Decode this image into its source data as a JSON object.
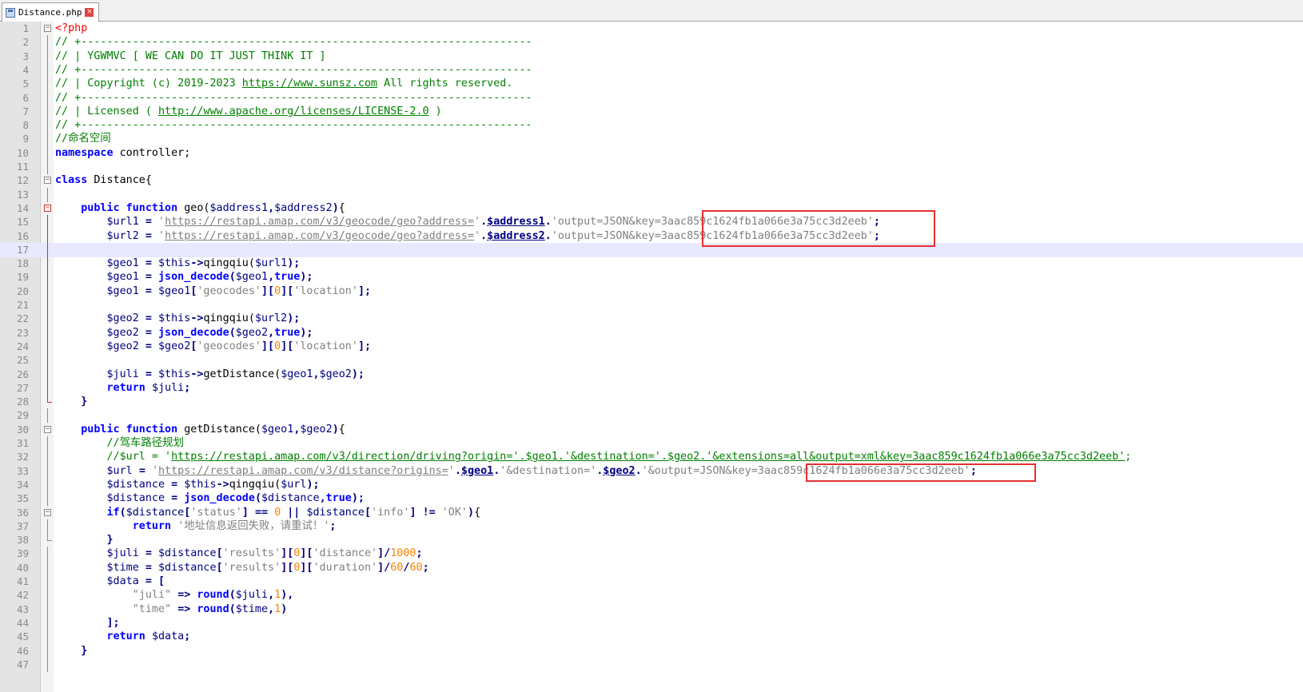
{
  "tab": {
    "filename": "Distance.php",
    "close_glyph": "×"
  },
  "lines": [
    [
      [
        "ph",
        "<?php"
      ]
    ],
    [
      [
        "cm",
        "// +----------------------------------------------------------------------"
      ]
    ],
    [
      [
        "cm",
        "// | YGWMVC [ WE CAN DO IT JUST THINK IT ]"
      ]
    ],
    [
      [
        "cm",
        "// +----------------------------------------------------------------------"
      ]
    ],
    [
      [
        "cm",
        "// | Copyright (c) 2019-2023 "
      ],
      [
        "cm url",
        "https://www.sunsz.com"
      ],
      [
        "cm",
        " All rights reserved."
      ]
    ],
    [
      [
        "cm",
        "// +----------------------------------------------------------------------"
      ]
    ],
    [
      [
        "cm",
        "// | Licensed ( "
      ],
      [
        "cm url",
        "http://www.apache.org/licenses/LICENSE-2.0"
      ],
      [
        "cm",
        " )"
      ]
    ],
    [
      [
        "cm",
        "// +----------------------------------------------------------------------"
      ]
    ],
    [
      [
        "cm",
        "//命名空间"
      ]
    ],
    [
      [
        "kw",
        "namespace"
      ],
      [
        "pl",
        " controller;"
      ]
    ],
    [],
    [
      [
        "kw",
        "class"
      ],
      [
        "pl",
        " Distance{"
      ]
    ],
    [],
    [
      [
        "pl",
        "    "
      ],
      [
        "kw",
        "public function"
      ],
      [
        "pl",
        " geo("
      ],
      [
        "vr",
        "$address1"
      ],
      [
        "op",
        ","
      ],
      [
        "vr",
        "$address2"
      ],
      [
        "op",
        ")"
      ],
      [
        "pl",
        "{"
      ]
    ],
    [
      [
        "pl",
        "        "
      ],
      [
        "vr",
        "$url1"
      ],
      [
        "pl",
        " "
      ],
      [
        "op",
        "="
      ],
      [
        "pl",
        " "
      ],
      [
        "st",
        "'"
      ],
      [
        "st url",
        "https://restapi.amap.com/v3/geocode/geo?address="
      ],
      [
        "st",
        "'"
      ],
      [
        "op",
        "."
      ],
      [
        "sv",
        "$address1"
      ],
      [
        "op",
        "."
      ],
      [
        "st",
        "'output=JSON&key=3aac859c1624fb1a066e3a75cc3d2eeb'"
      ],
      [
        "op",
        ";"
      ]
    ],
    [
      [
        "pl",
        "        "
      ],
      [
        "vr",
        "$url2"
      ],
      [
        "pl",
        " "
      ],
      [
        "op",
        "="
      ],
      [
        "pl",
        " "
      ],
      [
        "st",
        "'"
      ],
      [
        "st url",
        "https://restapi.amap.com/v3/geocode/geo?address="
      ],
      [
        "st",
        "'"
      ],
      [
        "op",
        "."
      ],
      [
        "sv",
        "$address2"
      ],
      [
        "op",
        "."
      ],
      [
        "st",
        "'output=JSON&key=3aac859c1624fb1a066e3a75cc3d2eeb'"
      ],
      [
        "op",
        ";"
      ]
    ],
    [],
    [
      [
        "pl",
        "        "
      ],
      [
        "vr",
        "$geo1"
      ],
      [
        "pl",
        " "
      ],
      [
        "op",
        "="
      ],
      [
        "pl",
        " "
      ],
      [
        "vr",
        "$this"
      ],
      [
        "op",
        "->"
      ],
      [
        "pl",
        "qingqiu("
      ],
      [
        "vr",
        "$url1"
      ],
      [
        "op",
        ");"
      ]
    ],
    [
      [
        "pl",
        "        "
      ],
      [
        "vr",
        "$geo1"
      ],
      [
        "pl",
        " "
      ],
      [
        "op",
        "="
      ],
      [
        "pl",
        " "
      ],
      [
        "kw",
        "json_decode"
      ],
      [
        "op",
        "("
      ],
      [
        "vr",
        "$geo1"
      ],
      [
        "op",
        ","
      ],
      [
        "kw",
        "true"
      ],
      [
        "op",
        ");"
      ]
    ],
    [
      [
        "pl",
        "        "
      ],
      [
        "vr",
        "$geo1"
      ],
      [
        "pl",
        " "
      ],
      [
        "op",
        "="
      ],
      [
        "pl",
        " "
      ],
      [
        "vr",
        "$geo1"
      ],
      [
        "op",
        "["
      ],
      [
        "st",
        "'geocodes'"
      ],
      [
        "op",
        "]["
      ],
      [
        "nu",
        "0"
      ],
      [
        "op",
        "]["
      ],
      [
        "st",
        "'location'"
      ],
      [
        "op",
        "];"
      ]
    ],
    [],
    [
      [
        "pl",
        "        "
      ],
      [
        "vr",
        "$geo2"
      ],
      [
        "pl",
        " "
      ],
      [
        "op",
        "="
      ],
      [
        "pl",
        " "
      ],
      [
        "vr",
        "$this"
      ],
      [
        "op",
        "->"
      ],
      [
        "pl",
        "qingqiu("
      ],
      [
        "vr",
        "$url2"
      ],
      [
        "op",
        ");"
      ]
    ],
    [
      [
        "pl",
        "        "
      ],
      [
        "vr",
        "$geo2"
      ],
      [
        "pl",
        " "
      ],
      [
        "op",
        "="
      ],
      [
        "pl",
        " "
      ],
      [
        "kw",
        "json_decode"
      ],
      [
        "op",
        "("
      ],
      [
        "vr",
        "$geo2"
      ],
      [
        "op",
        ","
      ],
      [
        "kw",
        "true"
      ],
      [
        "op",
        ");"
      ]
    ],
    [
      [
        "pl",
        "        "
      ],
      [
        "vr",
        "$geo2"
      ],
      [
        "pl",
        " "
      ],
      [
        "op",
        "="
      ],
      [
        "pl",
        " "
      ],
      [
        "vr",
        "$geo2"
      ],
      [
        "op",
        "["
      ],
      [
        "st",
        "'geocodes'"
      ],
      [
        "op",
        "]["
      ],
      [
        "nu",
        "0"
      ],
      [
        "op",
        "]["
      ],
      [
        "st",
        "'location'"
      ],
      [
        "op",
        "];"
      ]
    ],
    [],
    [
      [
        "pl",
        "        "
      ],
      [
        "vr",
        "$juli"
      ],
      [
        "pl",
        " "
      ],
      [
        "op",
        "="
      ],
      [
        "pl",
        " "
      ],
      [
        "vr",
        "$this"
      ],
      [
        "op",
        "->"
      ],
      [
        "pl",
        "getDistance("
      ],
      [
        "vr",
        "$geo1"
      ],
      [
        "op",
        ","
      ],
      [
        "vr",
        "$geo2"
      ],
      [
        "op",
        ");"
      ]
    ],
    [
      [
        "pl",
        "        "
      ],
      [
        "kw",
        "return"
      ],
      [
        "pl",
        " "
      ],
      [
        "vr",
        "$juli"
      ],
      [
        "op",
        ";"
      ]
    ],
    [
      [
        "pl",
        "    "
      ],
      [
        "op",
        "}"
      ]
    ],
    [],
    [
      [
        "pl",
        "    "
      ],
      [
        "kw",
        "public function"
      ],
      [
        "pl",
        " getDistance("
      ],
      [
        "vr",
        "$geo1"
      ],
      [
        "op",
        ","
      ],
      [
        "vr",
        "$geo2"
      ],
      [
        "op",
        ")"
      ],
      [
        "pl",
        "{"
      ]
    ],
    [
      [
        "pl",
        "        "
      ],
      [
        "cm",
        "//驾车路径规划"
      ]
    ],
    [
      [
        "pl",
        "        "
      ],
      [
        "cm",
        "//$url = '"
      ],
      [
        "cm url",
        "https://restapi.amap.com/v3/direction/driving?origin='.$geo1.'&destination='.$geo2.'&extensions=all&output=xml&key=3aac859c1624fb1a066e3a75cc3d2eeb'"
      ],
      [
        "cm",
        ";"
      ]
    ],
    [
      [
        "pl",
        "        "
      ],
      [
        "vr",
        "$url"
      ],
      [
        "pl",
        " "
      ],
      [
        "op",
        "="
      ],
      [
        "pl",
        " "
      ],
      [
        "st",
        "'"
      ],
      [
        "st url",
        "https://restapi.amap.com/v3/distance?origins="
      ],
      [
        "st",
        "'"
      ],
      [
        "op",
        "."
      ],
      [
        "sv",
        "$geo1"
      ],
      [
        "op",
        "."
      ],
      [
        "st",
        "'&destination='"
      ],
      [
        "op",
        "."
      ],
      [
        "sv",
        "$geo2"
      ],
      [
        "op",
        "."
      ],
      [
        "st",
        "'&output=JSON&key=3aac859c1624fb1a066e3a75cc3d2eeb'"
      ],
      [
        "op",
        ";"
      ]
    ],
    [
      [
        "pl",
        "        "
      ],
      [
        "vr",
        "$distance"
      ],
      [
        "pl",
        " "
      ],
      [
        "op",
        "="
      ],
      [
        "pl",
        " "
      ],
      [
        "vr",
        "$this"
      ],
      [
        "op",
        "->"
      ],
      [
        "pl",
        "qingqiu("
      ],
      [
        "vr",
        "$url"
      ],
      [
        "op",
        ");"
      ]
    ],
    [
      [
        "pl",
        "        "
      ],
      [
        "vr",
        "$distance"
      ],
      [
        "pl",
        " "
      ],
      [
        "op",
        "="
      ],
      [
        "pl",
        " "
      ],
      [
        "kw",
        "json_decode"
      ],
      [
        "op",
        "("
      ],
      [
        "vr",
        "$distance"
      ],
      [
        "op",
        ","
      ],
      [
        "kw",
        "true"
      ],
      [
        "op",
        ");"
      ]
    ],
    [
      [
        "pl",
        "        "
      ],
      [
        "kw",
        "if"
      ],
      [
        "op",
        "("
      ],
      [
        "vr",
        "$distance"
      ],
      [
        "op",
        "["
      ],
      [
        "st",
        "'status'"
      ],
      [
        "op",
        "]"
      ],
      [
        "pl",
        " "
      ],
      [
        "op",
        "=="
      ],
      [
        "pl",
        " "
      ],
      [
        "nu",
        "0"
      ],
      [
        "pl",
        " "
      ],
      [
        "op",
        "||"
      ],
      [
        "pl",
        " "
      ],
      [
        "vr",
        "$distance"
      ],
      [
        "op",
        "["
      ],
      [
        "st",
        "'info'"
      ],
      [
        "op",
        "]"
      ],
      [
        "pl",
        " "
      ],
      [
        "op",
        "!="
      ],
      [
        "pl",
        " "
      ],
      [
        "st",
        "'OK'"
      ],
      [
        "op",
        ")"
      ],
      [
        "pl",
        "{"
      ]
    ],
    [
      [
        "pl",
        "            "
      ],
      [
        "kw",
        "return"
      ],
      [
        "pl",
        " "
      ],
      [
        "st",
        "'地址信息返回失败，请重试！'"
      ],
      [
        "op",
        ";"
      ]
    ],
    [
      [
        "pl",
        "        "
      ],
      [
        "op",
        "}"
      ]
    ],
    [
      [
        "pl",
        "        "
      ],
      [
        "vr",
        "$juli"
      ],
      [
        "pl",
        " "
      ],
      [
        "op",
        "="
      ],
      [
        "pl",
        " "
      ],
      [
        "vr",
        "$distance"
      ],
      [
        "op",
        "["
      ],
      [
        "st",
        "'results'"
      ],
      [
        "op",
        "]["
      ],
      [
        "nu",
        "0"
      ],
      [
        "op",
        "]["
      ],
      [
        "st",
        "'distance'"
      ],
      [
        "op",
        "]/"
      ],
      [
        "nu",
        "1000"
      ],
      [
        "op",
        ";"
      ]
    ],
    [
      [
        "pl",
        "        "
      ],
      [
        "vr",
        "$time"
      ],
      [
        "pl",
        " "
      ],
      [
        "op",
        "="
      ],
      [
        "pl",
        " "
      ],
      [
        "vr",
        "$distance"
      ],
      [
        "op",
        "["
      ],
      [
        "st",
        "'results'"
      ],
      [
        "op",
        "]["
      ],
      [
        "nu",
        "0"
      ],
      [
        "op",
        "]["
      ],
      [
        "st",
        "'duration'"
      ],
      [
        "op",
        "]/"
      ],
      [
        "nu",
        "60"
      ],
      [
        "op",
        "/"
      ],
      [
        "nu",
        "60"
      ],
      [
        "op",
        ";"
      ]
    ],
    [
      [
        "pl",
        "        "
      ],
      [
        "vr",
        "$data"
      ],
      [
        "pl",
        " "
      ],
      [
        "op",
        "="
      ],
      [
        "pl",
        " "
      ],
      [
        "op",
        "["
      ]
    ],
    [
      [
        "pl",
        "            "
      ],
      [
        "st",
        "\"juli\""
      ],
      [
        "pl",
        " "
      ],
      [
        "op",
        "=>"
      ],
      [
        "pl",
        " "
      ],
      [
        "kw",
        "round"
      ],
      [
        "op",
        "("
      ],
      [
        "vr",
        "$juli"
      ],
      [
        "op",
        ","
      ],
      [
        "nu",
        "1"
      ],
      [
        "op",
        "),"
      ]
    ],
    [
      [
        "pl",
        "            "
      ],
      [
        "st",
        "\"time\""
      ],
      [
        "pl",
        " "
      ],
      [
        "op",
        "=>"
      ],
      [
        "pl",
        " "
      ],
      [
        "kw",
        "round"
      ],
      [
        "op",
        "("
      ],
      [
        "vr",
        "$time"
      ],
      [
        "op",
        ","
      ],
      [
        "nu",
        "1"
      ],
      [
        "op",
        ")"
      ]
    ],
    [
      [
        "pl",
        "        "
      ],
      [
        "op",
        "];"
      ]
    ],
    [
      [
        "pl",
        "        "
      ],
      [
        "kw",
        "return"
      ],
      [
        "pl",
        " "
      ],
      [
        "vr",
        "$data"
      ],
      [
        "op",
        ";"
      ]
    ],
    [
      [
        "pl",
        "    "
      ],
      [
        "op",
        "}"
      ]
    ],
    []
  ]
}
